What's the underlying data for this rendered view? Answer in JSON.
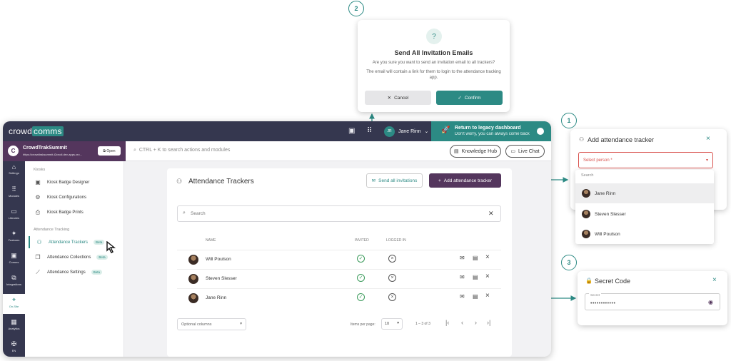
{
  "topbar": {
    "logo_a": "crowd",
    "logo_b": "comms",
    "user_initials": "JR",
    "user_name": "Jane Rinn",
    "legacy_title": "Return to legacy dashboard",
    "legacy_sub": "Don't worry, you can always come back"
  },
  "event": {
    "name": "CrowdTrakSummit",
    "url": "https://crowdtraksummit-t2crcdi.dev-apps.cro...",
    "open_label": "Open"
  },
  "search": {
    "placeholder": "CTRL + K to search actions and modules"
  },
  "header_buttons": {
    "knowledge": "Knowledge Hub",
    "chat": "Live Chat"
  },
  "rail": [
    "Settings",
    "Modules",
    "Libraries",
    "Features",
    "Comms",
    "Integrations",
    "On-Site",
    "Analytics",
    "EN"
  ],
  "subnav": {
    "kiosks_head": "Kiosks",
    "kiosk_items": [
      "Kiosk Badge Designer",
      "Kiosk Configurations",
      "Kiosk Badge Prints"
    ],
    "tracking_head": "Attendance Tracking",
    "tracking_items": [
      "Attendance Trackers",
      "Attendance Collections",
      "Attendance Settings"
    ],
    "beta": "Beta"
  },
  "card": {
    "title": "Attendance Trackers",
    "send_all": "Send all invitations",
    "add": "Add attendance tracker",
    "search": "Search",
    "col_name": "NAME",
    "col_invited": "INVITED",
    "col_logged": "LOGGED IN",
    "rows": [
      {
        "name": "Will Poulson"
      },
      {
        "name": "Steven Slesser"
      },
      {
        "name": "Jane Rinn"
      }
    ],
    "optional_columns": "Optional columns",
    "items_per_page": "Items per page:",
    "per_page": "10",
    "range": "1 – 3 of 3"
  },
  "annotations": {
    "n1": "1",
    "n2": "2",
    "n3": "3"
  },
  "dialog": {
    "title": "Send All Invitation Emails",
    "question": "Are you sure you want to send an invitation email to all trackers?",
    "detail": "The email will contain a link for them to login to the attendance tracking app.",
    "cancel": "Cancel",
    "confirm": "Confirm"
  },
  "add_panel": {
    "title": "Add attendance tracker",
    "select": "Select person *",
    "search": "Search",
    "options": [
      "Jane Rinn",
      "Steven Slesser",
      "Will Poulson"
    ]
  },
  "secret_panel": {
    "title": "Secret Code",
    "label": "Secret",
    "value": "••••••••••••"
  },
  "colors": {
    "teal": "#2c8a84",
    "navy": "#35374f",
    "purple": "#54365d"
  }
}
